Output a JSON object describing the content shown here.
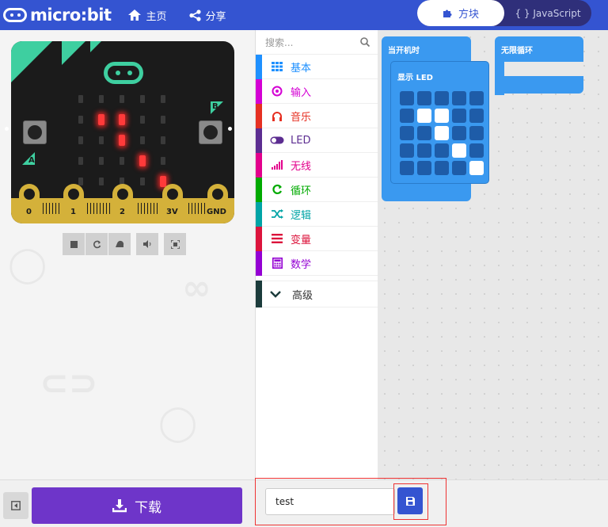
{
  "header": {
    "logo_text": "micro:bit",
    "home_label": "主页",
    "share_label": "分享",
    "tab_blocks_label": "方块",
    "tab_js_label": "JavaScript"
  },
  "board": {
    "button_a": "A",
    "button_b": "B",
    "pins": [
      "0",
      "1",
      "2",
      "3V",
      "GND"
    ],
    "led_on": [
      [
        1,
        1
      ],
      [
        1,
        2
      ],
      [
        2,
        2
      ],
      [
        3,
        3
      ],
      [
        4,
        4
      ]
    ]
  },
  "toolbox": {
    "search_placeholder": "搜索...",
    "categories": [
      {
        "label": "基本",
        "color": "#1e90ff",
        "icon": "grid-icon"
      },
      {
        "label": "输入",
        "color": "#d400d4",
        "icon": "target-icon"
      },
      {
        "label": "音乐",
        "color": "#e63022",
        "icon": "headphones-icon"
      },
      {
        "label": "LED",
        "color": "#5c2d91",
        "icon": "toggle-icon"
      },
      {
        "label": "无线",
        "color": "#e3008c",
        "icon": "signal-icon"
      },
      {
        "label": "循环",
        "color": "#00aa00",
        "icon": "refresh-icon"
      },
      {
        "label": "逻辑",
        "color": "#00a4a6",
        "icon": "shuffle-icon"
      },
      {
        "label": "变量",
        "color": "#dc143c",
        "icon": "list-icon"
      },
      {
        "label": "数学",
        "color": "#9400d3",
        "icon": "calculator-icon"
      }
    ],
    "advanced_label": "高级"
  },
  "workspace": {
    "on_start_label": "当开机时",
    "show_led_label": "显示 LED",
    "forever_label": "无限循环",
    "led_pattern": [
      [
        0,
        0,
        0,
        0,
        0
      ],
      [
        0,
        1,
        1,
        0,
        0
      ],
      [
        0,
        0,
        1,
        0,
        0
      ],
      [
        0,
        0,
        0,
        1,
        0
      ],
      [
        0,
        0,
        0,
        0,
        1
      ]
    ]
  },
  "bottom": {
    "download_label": "下载",
    "project_name": "test"
  },
  "colors": {
    "header": "#3454d1",
    "download": "#6e35c9",
    "block": "#3a99f0"
  }
}
